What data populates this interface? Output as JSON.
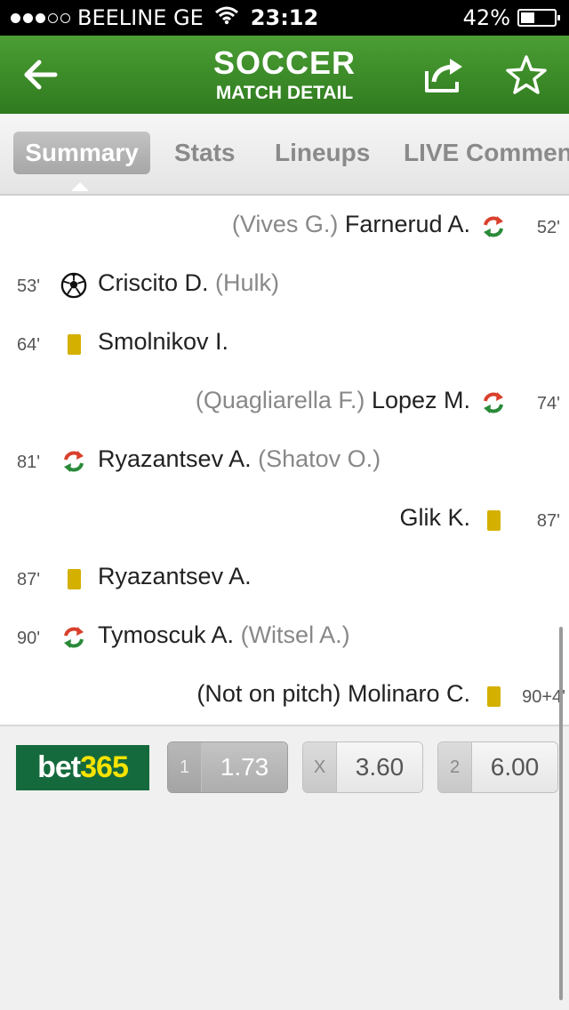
{
  "status_bar": {
    "carrier": "BEELINE GE",
    "time": "23:12",
    "battery": "42%",
    "battery_level": 0.42
  },
  "header": {
    "title": "SOCCER",
    "subtitle": "MATCH DETAIL",
    "back_icon": "arrow-left-icon",
    "share_icon": "share-icon",
    "favorite_icon": "star-outline-icon"
  },
  "tabs": [
    {
      "label": "Summary",
      "active": true
    },
    {
      "label": "Stats",
      "active": false
    },
    {
      "label": "Lineups",
      "active": false
    },
    {
      "label": "LIVE Commentary",
      "active": false
    }
  ],
  "events": [
    {
      "side": "away",
      "minute": "52'",
      "type": "substitution",
      "player": "Farnerud A.",
      "detail": "(Vives G.)"
    },
    {
      "side": "home",
      "minute": "53'",
      "type": "goal",
      "player": "Criscito D.",
      "detail": "(Hulk)"
    },
    {
      "side": "home",
      "minute": "64'",
      "type": "yellow-card",
      "player": "Smolnikov I.",
      "detail": ""
    },
    {
      "side": "away",
      "minute": "74'",
      "type": "substitution",
      "player": "Lopez M.",
      "detail": "(Quagliarella F.)"
    },
    {
      "side": "home",
      "minute": "81'",
      "type": "substitution",
      "player": "Ryazantsev A.",
      "detail": "(Shatov O.)"
    },
    {
      "side": "away",
      "minute": "87'",
      "type": "yellow-card",
      "player": "Glik K.",
      "detail": ""
    },
    {
      "side": "home",
      "minute": "87'",
      "type": "yellow-card",
      "player": "Ryazantsev A.",
      "detail": ""
    },
    {
      "side": "home",
      "minute": "90'",
      "type": "substitution",
      "player": "Tymoscuk A.",
      "detail": "(Witsel A.)"
    },
    {
      "side": "away",
      "minute": "90+4'",
      "type": "yellow-card",
      "player": "Molinaro C.",
      "detail": "(Not on pitch)"
    }
  ],
  "odds": {
    "bookmaker": {
      "part1": "bet",
      "part2": "365"
    },
    "items": [
      {
        "label": "1",
        "value": "1.73",
        "selected": true
      },
      {
        "label": "X",
        "value": "3.60",
        "selected": false
      },
      {
        "label": "2",
        "value": "6.00",
        "selected": false
      }
    ]
  },
  "colors": {
    "header_green": "#3d8c2a",
    "bookmaker_green": "#156a3d",
    "bookmaker_yellow": "#f6e300",
    "card_yellow": "#d4b000",
    "sub_red": "#d9402b",
    "sub_green": "#2a8a3a"
  }
}
